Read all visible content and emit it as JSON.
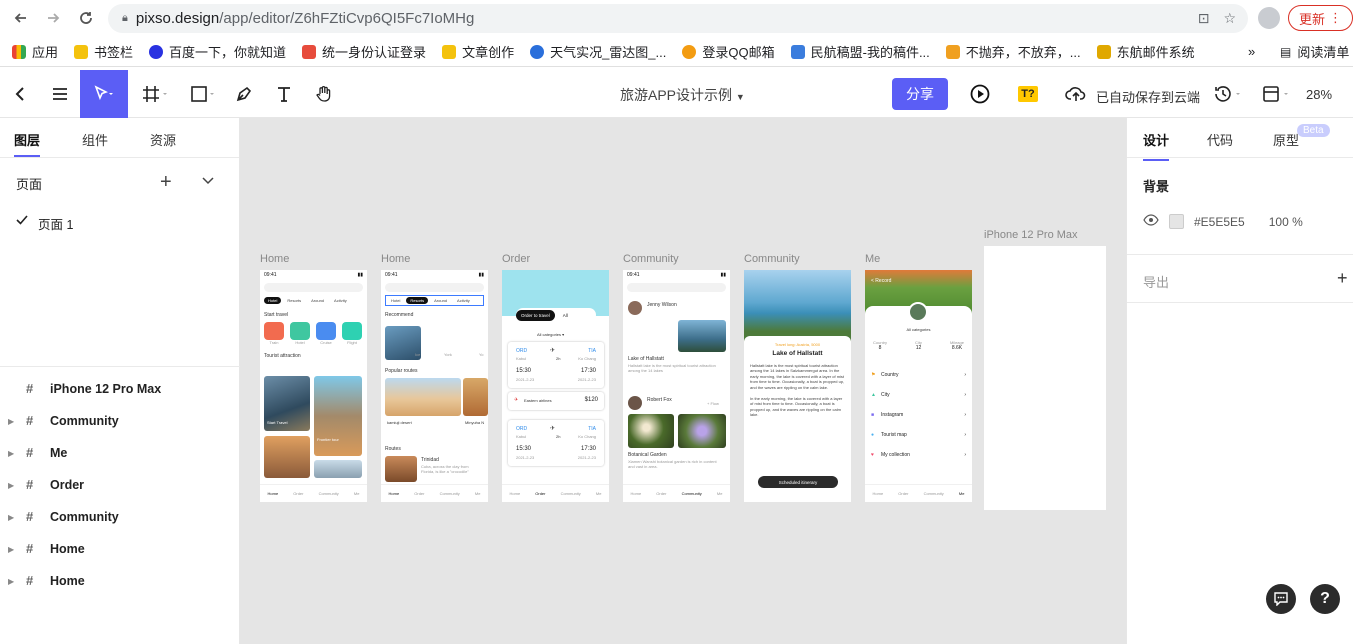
{
  "browser": {
    "url_host": "pixso.design",
    "url_path": "/app/editor/Z6hFZtiCvp6QI5Fc7IoMHg",
    "update_label": "更新"
  },
  "bookmarks": [
    {
      "label": "应用",
      "color": "#4285f4"
    },
    {
      "label": "书签栏",
      "color": "#f4c20d"
    },
    {
      "label": "百度一下，你就知道",
      "color": "#2932e1"
    },
    {
      "label": "统一身份认证登录",
      "color": "#e74c3c"
    },
    {
      "label": "文章创作",
      "color": "#f4c20d"
    },
    {
      "label": "天气实况_雷达图_...",
      "color": "#2a6fdb"
    },
    {
      "label": "登录QQ邮箱",
      "color": "#f39c12"
    },
    {
      "label": "民航稿盟-我的稿件...",
      "color": "#3b7ddd"
    },
    {
      "label": "不抛弃，不放弃，...",
      "color": "#f0a020"
    },
    {
      "label": "东航邮件系统",
      "color": "#e0a800"
    }
  ],
  "bookmarks_more": "»",
  "reading_list": "阅读清单",
  "toolbar": {
    "file_title": "旅游APP设计示例",
    "share_label": "分享",
    "t_badge": "T?",
    "saved_label": "已自动保存到云端",
    "zoom": "28%"
  },
  "left_panel": {
    "tabs": [
      "图层",
      "组件",
      "资源"
    ],
    "pages_title": "页面",
    "page_item": "页面 1",
    "layers": [
      "iPhone 12 Pro Max",
      "Community",
      "Me",
      "Order",
      "Community",
      "Home",
      "Home"
    ]
  },
  "canvas": {
    "frame_labels": [
      "Home",
      "Home",
      "Order",
      "Community",
      "Community",
      "Me",
      "iPhone 12 Pro Max"
    ],
    "home1": {
      "time": "09:41",
      "chips": [
        "Hotel",
        "Resorts",
        "Around",
        "Activity"
      ],
      "start_travel": "Start travel",
      "icons": [
        "Train",
        "Hotel",
        "Cruise",
        "Flight"
      ],
      "tourist_attraction": "Tourist attraction",
      "card1": "Start Travel",
      "card2": "Frontier tour"
    },
    "home2": {
      "time": "09:41",
      "chips": [
        "Hotel",
        "Resorts",
        "Around",
        "Activity"
      ],
      "recommend": "Recommend",
      "popular_routes": "Popular routes",
      "place1": "kamiuji desert",
      "place2": "Minyuha N",
      "routes": "Routes",
      "route_title": "Trinidad",
      "route_text": "Cuba, across the clay from Florida, is like a \"crocodile\""
    },
    "order": {
      "seg_active": "Order to travel",
      "seg_other": "All",
      "categories": "All categories ▾",
      "from": "ORD",
      "to": "TIA",
      "from_city": "Kabul",
      "to_city": "Ko Chang",
      "duration": "2h",
      "dep": "15:30",
      "arr": "17:30",
      "date": "2021-2-23",
      "airline": "Eastern airlines",
      "price": "$120"
    },
    "community1": {
      "user1": "Jenny Wilson",
      "post_title": "Lake of Hallstatt",
      "post_text": "Hallstatt lake is the most spiritual tourist attraction among the 14 lakes",
      "user2": "Robert Fox",
      "follow": "+ Flow",
      "garden_title": "Botanical Garden",
      "garden_text": "Xiamen Wanshi botanical garden is rich in content and vast in area."
    },
    "community2": {
      "meta": "Travel long: Austria, 5000",
      "title": "Lake of Hallstatt",
      "para1": "Hallstatt lake is the most spiritual tourist attraction among the 14 lakes in Salzkammergut area. In the early morning, the lake is covered with a layer of mist from time to time. Occasionally, a boat is propped up, and the waves are rippling on the calm lake.",
      "para2": "In the early morning, the lake is covered with a layer of mist from time to time. Occasionally, a boat is propped up, and the waves are rippling on the calm lake.",
      "button": "Scheduled itinerary"
    },
    "me": {
      "back": "< Record",
      "categories": "All categories",
      "stats": [
        {
          "label": "Country",
          "value": "8"
        },
        {
          "label": "City",
          "value": "12"
        },
        {
          "label": "Mileage",
          "value": "8.6K"
        }
      ],
      "menu": [
        "Country",
        "City",
        "Instagram",
        "Tourist map",
        "My collection"
      ]
    },
    "tabbar": [
      "Home",
      "Order",
      "Community",
      "Me"
    ]
  },
  "right_panel": {
    "tabs": [
      "设计",
      "代码",
      "原型"
    ],
    "beta": "Beta",
    "background_title": "背景",
    "bg_color": "#E5E5E5",
    "bg_opacity": "100 %",
    "export_title": "导出"
  }
}
